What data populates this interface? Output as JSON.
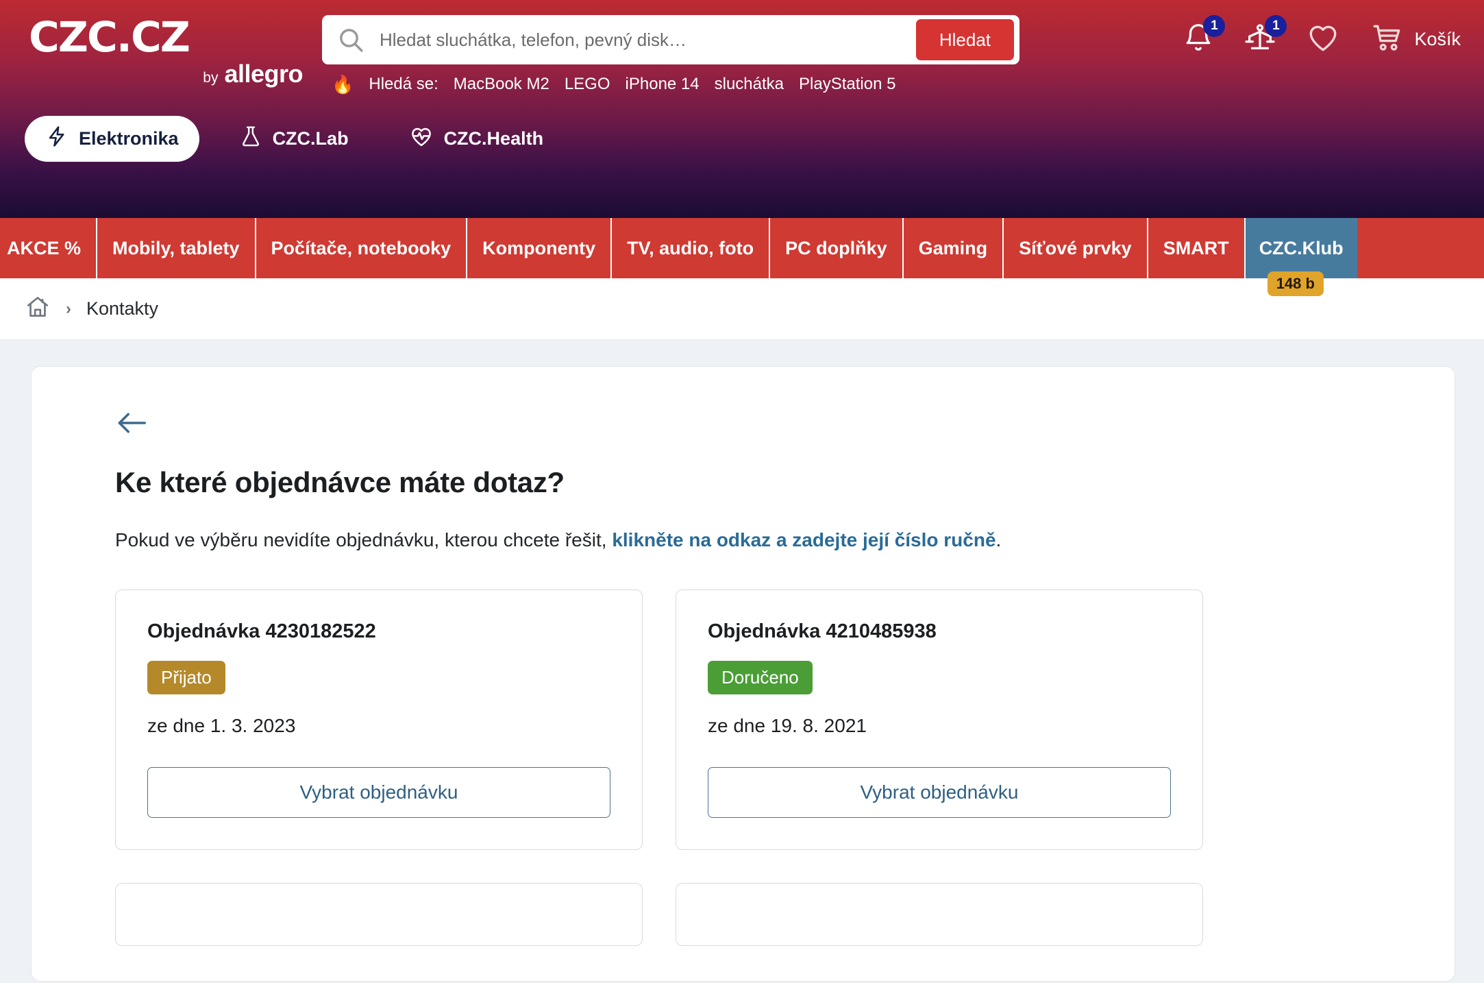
{
  "header": {
    "logo_main": "CZC.CZ",
    "logo_by": "by",
    "logo_allegro": "allegro",
    "search": {
      "placeholder": "Hledat sluchátka, telefon, pevný disk…",
      "value": "",
      "button_label": "Hledat"
    },
    "trending": {
      "fire": "🔥",
      "label": "Hledá se:",
      "items": [
        "MacBook M2",
        "LEGO",
        "iPhone 14",
        "sluchátka",
        "PlayStation 5"
      ]
    },
    "actions": {
      "notifications_badge": "1",
      "compare_badge": "1",
      "cart_label": "Košík"
    },
    "section_tabs": [
      {
        "label": "Elektronika",
        "icon": "lightning-icon",
        "active": true
      },
      {
        "label": "CZC.Lab",
        "icon": "flask-icon",
        "active": false
      },
      {
        "label": "CZC.Health",
        "icon": "heart-pulse-icon",
        "active": false
      }
    ]
  },
  "category_nav": {
    "items": [
      "AKCE %",
      "Mobily, tablety",
      "Počítače, notebooky",
      "Komponenty",
      "TV, audio, foto",
      "PC doplňky",
      "Gaming",
      "Síťové prvky",
      "SMART"
    ],
    "klub": {
      "label": "CZC.Klub",
      "points_badge": "148 b"
    }
  },
  "breadcrumb": {
    "home_icon": "home-icon",
    "separator": "›",
    "current": "Kontakty"
  },
  "main": {
    "back_icon": "arrow-left-icon",
    "title": "Ke které objednávce máte dotaz?",
    "lead_before": "Pokud ve výběru nevidíte objednávku, kterou chcete řešit, ",
    "lead_link": "klikněte na odkaz a zadejte její číslo ručně",
    "lead_after": ".",
    "orders": [
      {
        "number": "Objednávka 4230182522",
        "status": "Přijato",
        "status_color": "#b5892a",
        "date": "ze dne 1. 3. 2023",
        "button_label": "Vybrat objednávku"
      },
      {
        "number": "Objednávka 4210485938",
        "status": "Doručeno",
        "status_color": "#4a9e35",
        "date": "ze dne 19. 8. 2021",
        "button_label": "Vybrat objednávku"
      }
    ]
  },
  "colors": {
    "brand_red": "#cf3a33",
    "header_gradient_top": "#bd2b31",
    "header_gradient_bottom": "#1b0c33",
    "klub_blue": "#477b9e",
    "klub_badge_gold": "#e0a42b",
    "link_blue": "#2a6b96",
    "page_bg": "#eef2f6"
  }
}
